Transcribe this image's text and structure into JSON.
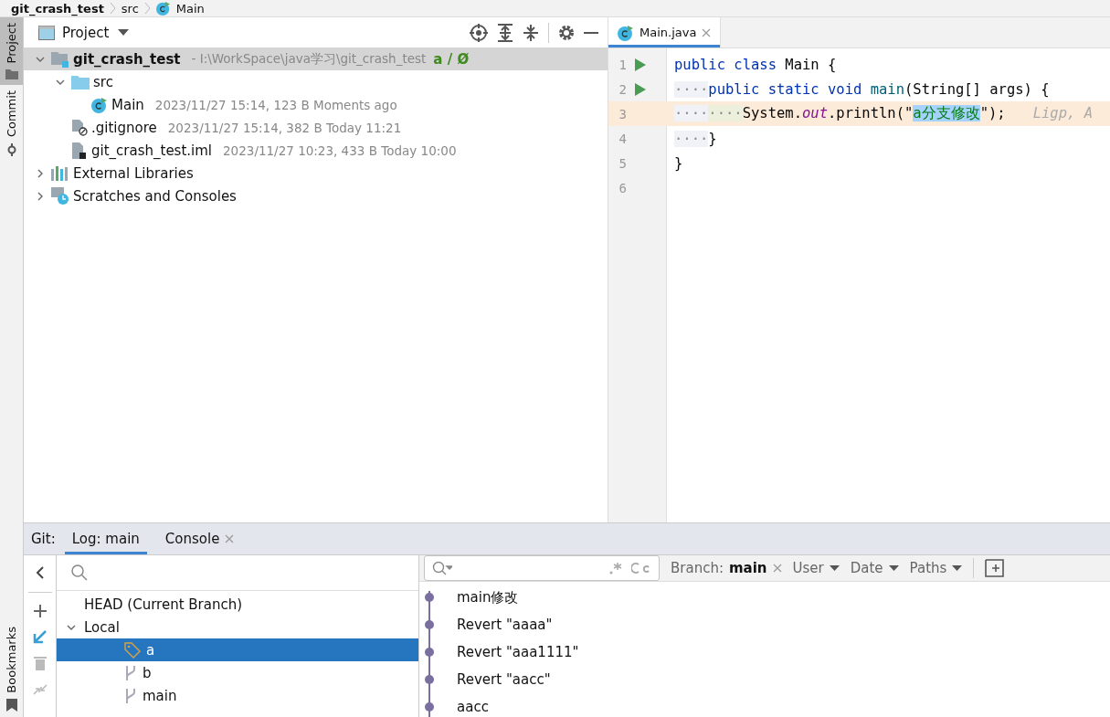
{
  "breadcrumb": [
    {
      "label": "git_crash_test",
      "kind": "project"
    },
    {
      "label": "src",
      "kind": "folder"
    },
    {
      "label": "Main",
      "kind": "class"
    }
  ],
  "side_tools": [
    {
      "label": "Project",
      "kind": "project",
      "selected": true
    },
    {
      "label": "Commit",
      "kind": "commit",
      "selected": false
    }
  ],
  "bottom_side_tools": [
    {
      "label": "Bookmarks",
      "kind": "bookmark",
      "selected": false
    }
  ],
  "project_panel": {
    "title": "Project",
    "tree": [
      {
        "label": "git_crash_test",
        "kind": "module",
        "detail": "- I:\\WorkSpace\\java学习\\git_crash_test",
        "branch": "a / Ø",
        "selected": true,
        "expanded": true,
        "children": [
          {
            "label": "src",
            "kind": "folder",
            "selected": false,
            "expanded": true,
            "children": [
              {
                "label": "Main",
                "kind": "class",
                "detail": "2023/11/27 15:14, 123 B Moments ago",
                "selected": false
              }
            ]
          },
          {
            "label": ".gitignore",
            "kind": "ignore",
            "detail": "2023/11/27 15:14, 382 B Today 11:21",
            "selected": false
          },
          {
            "label": "git_crash_test.iml",
            "kind": "iml",
            "detail": "2023/11/27 10:23, 433 B Today 10:00",
            "selected": false
          }
        ]
      },
      {
        "label": "External Libraries",
        "kind": "libraries",
        "selected": false,
        "expanded": false
      },
      {
        "label": "Scratches and Consoles",
        "kind": "scratches",
        "selected": false,
        "expanded": false
      }
    ]
  },
  "editor": {
    "tabs": [
      {
        "label": "Main.java",
        "selected": true
      }
    ],
    "lines": [
      {
        "number": "1",
        "runnable": true,
        "current": false,
        "tokens": [
          {
            "text": "public class ",
            "kind": "kw"
          },
          {
            "text": "Main {",
            "kind": "plain"
          }
        ]
      },
      {
        "number": "2",
        "runnable": true,
        "current": false,
        "tokens": [
          {
            "text": "····",
            "kind": "indent"
          },
          {
            "text": "public static void ",
            "kind": "kw"
          },
          {
            "text": "main",
            "kind": "method"
          },
          {
            "text": "(String[] args) {",
            "kind": "plain"
          }
        ]
      },
      {
        "number": "3",
        "runnable": false,
        "current": true,
        "tokens": [
          {
            "text": "····",
            "kind": "indent"
          },
          {
            "text": "····",
            "kind": "indent2"
          },
          {
            "text": "System.",
            "kind": "plain"
          },
          {
            "text": "out",
            "kind": "field"
          },
          {
            "text": ".println(\"",
            "kind": "plain"
          },
          {
            "text": "a分支修改",
            "kind": "selection"
          },
          {
            "text": "\");",
            "kind": "plain"
          },
          {
            "text": "Ligp, A",
            "kind": "hint"
          }
        ]
      },
      {
        "number": "4",
        "runnable": false,
        "current": false,
        "tokens": [
          {
            "text": "····",
            "kind": "indent"
          },
          {
            "text": "}",
            "kind": "plain"
          }
        ]
      },
      {
        "number": "5",
        "runnable": false,
        "current": false,
        "tokens": [
          {
            "text": "}",
            "kind": "plain"
          }
        ]
      },
      {
        "number": "6",
        "runnable": false,
        "current": false
      }
    ]
  },
  "git_panel": {
    "label": "Git:",
    "tabs": [
      {
        "label": "Log: main",
        "selected": true,
        "closable": false
      },
      {
        "label": "Console",
        "selected": false,
        "closable": true
      }
    ],
    "branches": [
      {
        "label": "HEAD (Current Branch)",
        "selected": false
      },
      {
        "label": "Local",
        "selected": false,
        "expanded": true,
        "children": [
          {
            "label": "a",
            "kind": "tag",
            "selected": true
          },
          {
            "label": "b",
            "kind": "branch",
            "selected": false
          },
          {
            "label": "main",
            "kind": "branch",
            "selected": false
          }
        ]
      }
    ],
    "filters": {
      "branch_label": "Branch:",
      "branch_value": "main",
      "items": [
        "User",
        "Date",
        "Paths"
      ]
    },
    "commits": [
      "main修改",
      "Revert \"aaaa\"",
      "Revert \"aaa1111\"",
      "Revert \"aacc\"",
      "aacc"
    ]
  }
}
